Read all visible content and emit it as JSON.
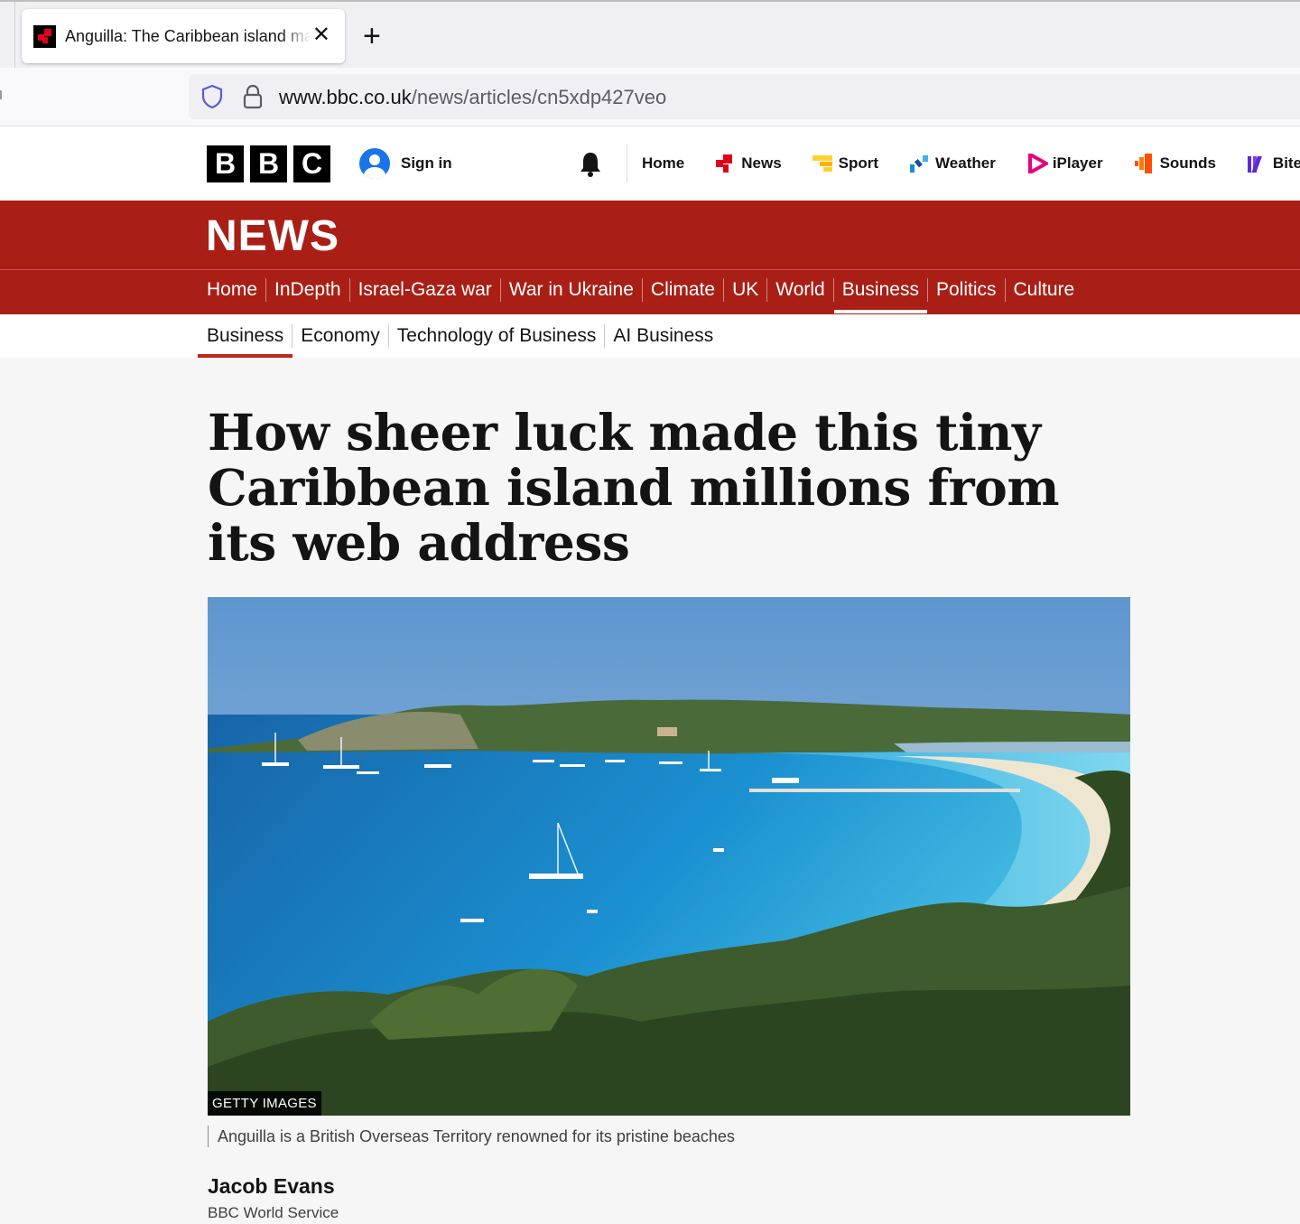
{
  "browser": {
    "tab_title": "Anguilla: The Caribbean island making millions from .ai",
    "url_host": "www.bbc.co.uk",
    "url_path": "/news/articles/cn5xdp427veo"
  },
  "masthead": {
    "logo": [
      "B",
      "B",
      "C"
    ],
    "signin_label": "Sign in",
    "nav": [
      {
        "label": "Home",
        "icon": "none"
      },
      {
        "label": "News",
        "icon": "news-icon"
      },
      {
        "label": "Sport",
        "icon": "sport-icon"
      },
      {
        "label": "Weather",
        "icon": "weather-icon"
      },
      {
        "label": "iPlayer",
        "icon": "iplayer-icon"
      },
      {
        "label": "Sounds",
        "icon": "sounds-icon"
      },
      {
        "label": "Bitesize",
        "icon": "bitesize-icon"
      }
    ]
  },
  "news": {
    "title": "NEWS",
    "sections": [
      "Home",
      "InDepth",
      "Israel-Gaza war",
      "War in Ukraine",
      "Climate",
      "UK",
      "World",
      "Business",
      "Politics",
      "Culture"
    ],
    "active_section": "Business",
    "subsections": [
      "Business",
      "Economy",
      "Technology of Business",
      "AI Business"
    ],
    "active_subsection": "Business"
  },
  "article": {
    "headline": "How sheer luck made this tiny Caribbean island millions from its web address",
    "image_credit": "GETTY IMAGES",
    "caption": "Anguilla is a British Overseas Territory renowned for its pristine beaches",
    "author": "Jacob Evans",
    "author_org": "BBC World Service"
  },
  "colors": {
    "news_red": "#a91f16",
    "subnav_accent": "#c0261a",
    "signin_blue": "#1a73e8"
  }
}
